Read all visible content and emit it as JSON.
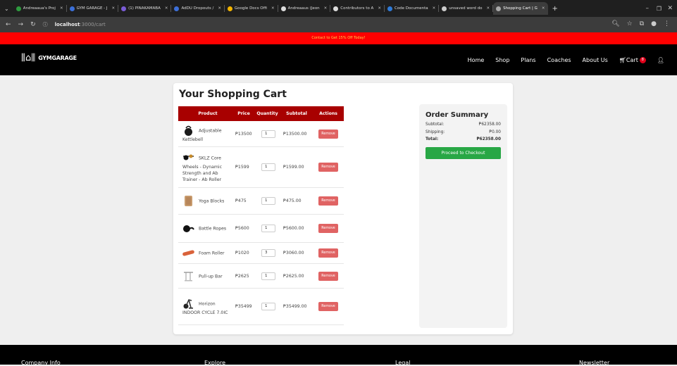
{
  "browser": {
    "tabs": [
      {
        "label": "Andreaaua's Proj",
        "color": "#2e9b3f"
      },
      {
        "label": "GYM GARAGE - J",
        "color": "#3b6fd8"
      },
      {
        "label": "(1) PINAKAMABA",
        "color": "#7a5cd6"
      },
      {
        "label": "AdDU Dropouts /",
        "color": "#3d6fd8"
      },
      {
        "label": "Google Docs Offi",
        "color": "#f3b400"
      },
      {
        "label": "Andreaaus (Jeon",
        "color": "#dddddd"
      },
      {
        "label": "Contributors to A",
        "color": "#dddddd"
      },
      {
        "label": "Code Documenta",
        "color": "#2f7bd8"
      },
      {
        "label": "unsaved word do",
        "color": "#cccccc"
      },
      {
        "label": "Shopping Cart | G",
        "color": "#aaaaaa",
        "active": true
      }
    ],
    "url_host": "localhost",
    "url_path": ":3000/cart"
  },
  "promo": {
    "text": "Contact to Get 15% Off Today!"
  },
  "site": {
    "logo_text": "GYMGARAGE",
    "nav": [
      "Home",
      "Shop",
      "Plans",
      "Coaches",
      "About Us",
      "Cart"
    ],
    "cart_count": "8"
  },
  "cart": {
    "title": "Your Shopping Cart",
    "headers": [
      "Product",
      "Price",
      "Quantity",
      "Subtotal",
      "Actions"
    ],
    "remove_label": "Remove",
    "items": [
      {
        "name": "Adjustable Kettlebell",
        "price": "₱13500",
        "qty": "1",
        "subtotal": "₱13500.00",
        "icon": "kettlebell-icon"
      },
      {
        "name": "SKLZ Core Wheels - Dynamic Strength and Ab Trainer - Ab Roller",
        "price": "₱1599",
        "qty": "1",
        "subtotal": "₱1599.00",
        "icon": "ab-roller-icon"
      },
      {
        "name": "Yoga Blocks",
        "price": "₱475",
        "qty": "1",
        "subtotal": "₱475.00",
        "icon": "yoga-block-icon"
      },
      {
        "name": "Battle Ropes",
        "price": "₱5600",
        "qty": "1",
        "subtotal": "₱5600.00",
        "icon": "battle-rope-icon"
      },
      {
        "name": "Foam Roller",
        "price": "₱1020",
        "qty": "3",
        "subtotal": "₱3060.00",
        "icon": "foam-roller-icon"
      },
      {
        "name": "Pull-up Bar",
        "price": "₱2625",
        "qty": "1",
        "subtotal": "₱2625.00",
        "icon": "pullup-bar-icon"
      },
      {
        "name": "Horizon INDOOR CYCLE 7.0IC",
        "price": "₱35499",
        "qty": "1",
        "subtotal": "₱35499.00",
        "icon": "indoor-cycle-icon"
      }
    ]
  },
  "summary": {
    "title": "Order Summary",
    "subtotal_label": "Subtotal:",
    "subtotal": "₱62358.00",
    "shipping_label": "Shipping:",
    "shipping": "₱0.00",
    "total_label": "Total:",
    "total": "₱62358.00",
    "checkout_label": "Proceed to Checkout"
  },
  "footer": {
    "headings": [
      "Company Info",
      "Explore",
      "Legal",
      "Newsletter"
    ]
  },
  "colors": {
    "accent_red": "#a80000",
    "promo_red": "#ff0000",
    "checkout_green": "#28a745",
    "remove_red": "#e06363"
  }
}
